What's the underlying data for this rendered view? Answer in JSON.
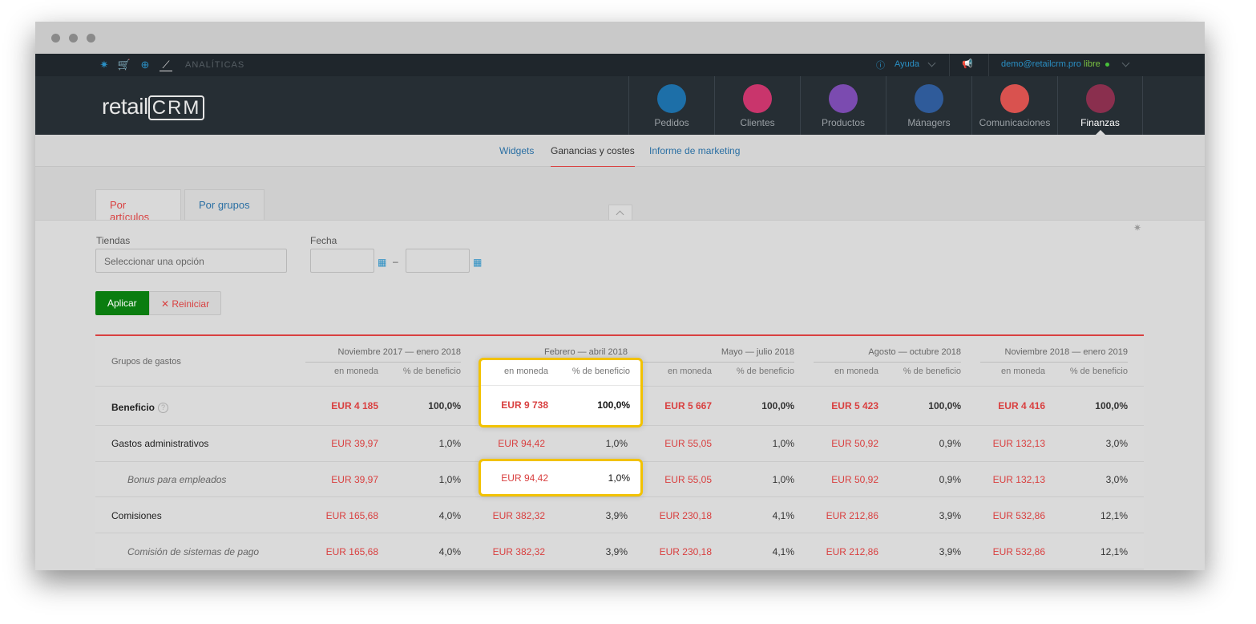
{
  "topbar": {
    "section_label": "ANALÍTICAS",
    "help_label": "Ayuda",
    "email": "demo@retailcrm.pro",
    "plan": "libre"
  },
  "header": {
    "logo_text": "retail",
    "logo_boxed": "CRM",
    "nav": [
      {
        "label": "Pedidos",
        "color": "#1d6fa8"
      },
      {
        "label": "Clientes",
        "color": "#c9356c"
      },
      {
        "label": "Productos",
        "color": "#7b4bb0"
      },
      {
        "label": "Mánagers",
        "color": "#2f5b9a"
      },
      {
        "label": "Comunicaciones",
        "color": "#d9524f"
      },
      {
        "label": "Finanzas",
        "color": "#8a2f4e"
      }
    ]
  },
  "subnav": {
    "tabs": [
      "Widgets",
      "Ganancias y costes",
      "Informe de marketing"
    ]
  },
  "tabs": {
    "by_articles": "Por artículos",
    "by_groups": "Por grupos"
  },
  "filters": {
    "stores_label": "Tiendas",
    "stores_placeholder": "Seleccionar una opción",
    "date_label": "Fecha",
    "date_dash": "–",
    "apply": "Aplicar",
    "reset": "Reiniciar"
  },
  "table": {
    "name_header": "Grupos de gastos",
    "sub_money": "en moneda",
    "sub_pct": "% de beneficio",
    "periods": [
      "Noviembre 2017 — enero 2018",
      "Febrero — abril 2018",
      "Mayo — julio 2018",
      "Agosto — octubre 2018",
      "Noviembre 2018 — enero 2019"
    ],
    "rows": [
      {
        "name": "Beneficio",
        "money": [
          "EUR 4 185",
          "EUR 9 738",
          "EUR 5 667",
          "EUR 5 423",
          "EUR 4 416"
        ],
        "pct": [
          "100,0%",
          "100,0%",
          "100,0%",
          "100,0%",
          "100,0%"
        ]
      },
      {
        "name": "Gastos administrativos",
        "money": [
          "EUR 39,97",
          "EUR 94,42",
          "EUR 55,05",
          "EUR 50,92",
          "EUR 132,13"
        ],
        "pct": [
          "1,0%",
          "1,0%",
          "1,0%",
          "0,9%",
          "3,0%"
        ]
      },
      {
        "name": "Bonus para empleados",
        "money": [
          "EUR 39,97",
          "EUR 94,42",
          "EUR 55,05",
          "EUR 50,92",
          "EUR 132,13"
        ],
        "pct": [
          "1,0%",
          "1,0%",
          "1,0%",
          "0,9%",
          "3,0%"
        ]
      },
      {
        "name": "Comisiones",
        "money": [
          "EUR 165,68",
          "EUR 382,32",
          "EUR 230,18",
          "EUR 212,86",
          "EUR 532,86"
        ],
        "pct": [
          "4,0%",
          "3,9%",
          "4,1%",
          "3,9%",
          "12,1%"
        ]
      },
      {
        "name": "Comisión de sistemas de pago",
        "money": [
          "EUR 165,68",
          "EUR 382,32",
          "EUR 230,18",
          "EUR 212,86",
          "EUR 532,86"
        ],
        "pct": [
          "4,0%",
          "3,9%",
          "4,1%",
          "3,9%",
          "12,1%"
        ]
      }
    ]
  },
  "colors": {
    "accent_red": "#d94040",
    "link_blue": "#2a6fa3",
    "apply_green": "#0a7d10",
    "highlight": "#f2c200"
  }
}
